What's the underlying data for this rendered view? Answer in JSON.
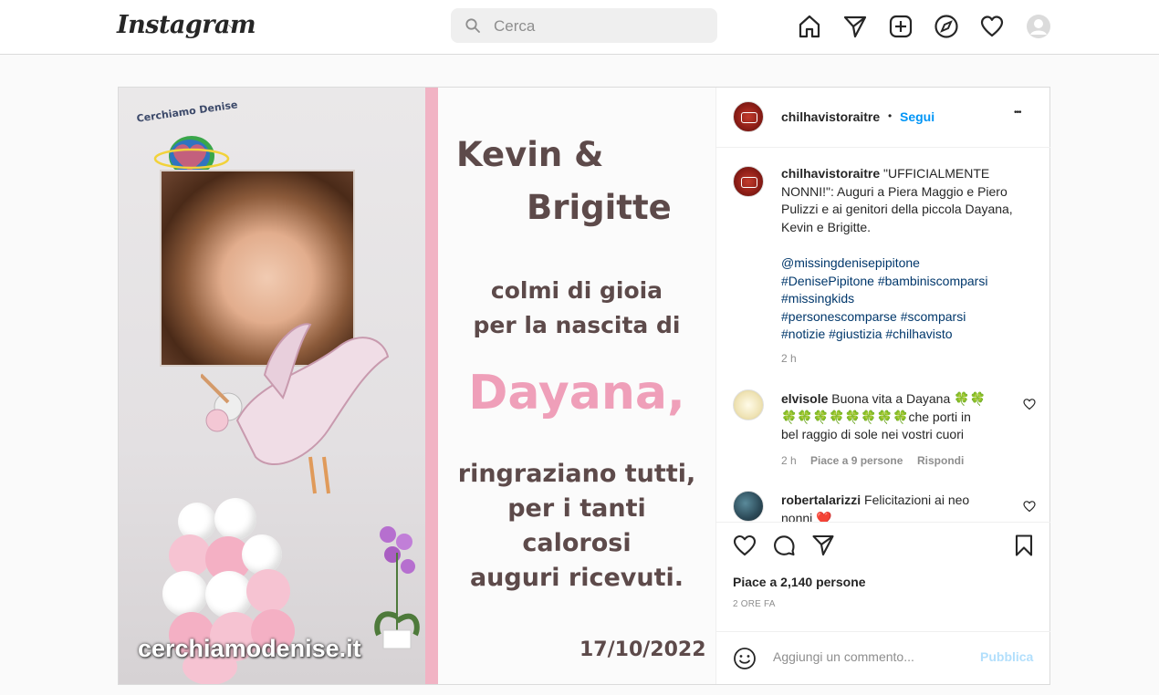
{
  "header": {
    "logo": "Instagram",
    "search_placeholder": "Cerca"
  },
  "post": {
    "image": {
      "watermark": "cerchiamodenise.it",
      "logo_text": "Cerchiamo Denise",
      "line1": "Kevin &",
      "line2": "Brigitte",
      "line3": "colmi di gioia",
      "line4": "per la nascita di",
      "line5": "Dayana,",
      "line6": "ringraziano tutti,",
      "line7": "per i tanti",
      "line8": "calorosi",
      "line9": "auguri ricevuti.",
      "date": "17/10/2022"
    },
    "author": {
      "username": "chilhavistoraitre",
      "separator": "•",
      "follow_label": "Segui",
      "more_label": "•••"
    },
    "caption": {
      "username": "chilhavistoraitre",
      "text": "\"UFFICIALMENTE NONNI!\": Auguri a Piera Maggio e Piero Pulizzi e ai genitori della piccola Dayana, Kevin e Brigitte.",
      "mention": "@missingdenisepipitone",
      "tags_line1": "#DenisePipitone #bambiniscomparsi",
      "tags_line2": "#missingkids",
      "tags_line3": "#personescomparse #scomparsi",
      "tags_line4": "#notizie #giustizia #chilhavisto",
      "time": "2 h"
    },
    "comments": [
      {
        "username": "elvisole",
        "text_line1": "Buona vita a Dayana 🍀🍀",
        "text_line2": "🍀🍀🍀🍀🍀🍀🍀🍀che porti in",
        "text_line3": "bel raggio di sole nei vostri cuori",
        "time": "2 h",
        "likes": "Piace a 9 persone",
        "reply": "Rispondi"
      },
      {
        "username": "robertalarizzi",
        "text_line1": "Felicitazioni ai neo",
        "text_line2": "nonni ❤️"
      }
    ],
    "likes_label": "Piace a 2,140 persone",
    "date_label": "2 ORE FA",
    "comment_placeholder": "Aggiungi un commento...",
    "publish_label": "Pubblica"
  },
  "colors": {
    "link": "#00376b",
    "follow": "#0095f6",
    "publish_disabled": "#b2dffc",
    "pink_text": "#ef9fb9"
  }
}
